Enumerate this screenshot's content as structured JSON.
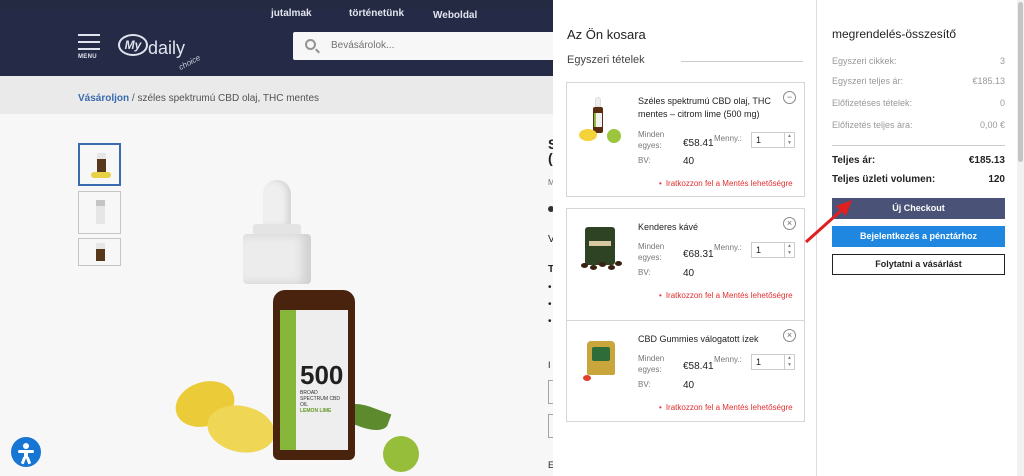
{
  "header": {
    "nav_links": [
      "jutalmak",
      "történetünk",
      "Weboldal"
    ],
    "menu_label": "MENU",
    "logo_my": "My",
    "logo_daily": "daily",
    "logo_choice": "choice",
    "search_placeholder": "Bevásárolok..."
  },
  "breadcrumb": {
    "home": "Vásároljon",
    "rest": " / széles spektrumú CBD olaj, THC mentes"
  },
  "product_label": {
    "number": "500",
    "sub": "BROAD SPECTRUM CBD OIL",
    "flavor": "LEMON LIME"
  },
  "product_fragments": [
    "S",
    "(",
    "M",
    "V",
    "T",
    "•",
    "•",
    "•",
    "I",
    "E"
  ],
  "cart": {
    "title": "Az Ön kosara",
    "section_label": "Egyszeri tételek",
    "unit_label": "Minden egyes:",
    "qty_label": "Menny.:",
    "bv_label": "BV:",
    "promo_text": "Iratkozzon fel a Mentés lehetőségre",
    "items": [
      {
        "name": "Széles spektrumú CBD olaj, THC mentes – citrom lime (500 mg)",
        "price": "€58.41",
        "qty": "1",
        "bv": "40"
      },
      {
        "name": "Kenderes kávé",
        "price": "€68.31",
        "qty": "1",
        "bv": "40"
      },
      {
        "name": "CBD Gummies válogatott ízek",
        "price": "€58.41",
        "qty": "1",
        "bv": "40"
      }
    ]
  },
  "summary": {
    "title": "megrendelés-összesítő",
    "rows": [
      {
        "label": "Egyszeri cikkek:",
        "value": "3"
      },
      {
        "label": "Egyszeri teljes ár:",
        "value": "€185.13"
      },
      {
        "label": "Előfizetéses tételek:",
        "value": "0"
      },
      {
        "label": "Előfizetés teljes ára:",
        "value": "0,00 €"
      }
    ],
    "total_label": "Teljes ár:",
    "total_value": "€185.13",
    "volume_label": "Teljes üzleti volumen:",
    "volume_value": "120",
    "btn_checkout": "Új Checkout",
    "btn_login": "Bejelentkezés a pénztárhoz",
    "btn_continue": "Folytatni a vásárlást"
  },
  "icons": [
    "search-icon",
    "menu-icon",
    "close-icon",
    "accessibility-icon",
    "arrow-icon"
  ],
  "colors": {
    "header": "#272d4a",
    "checkout": "#4a5278",
    "login": "#1f87e0",
    "promo": "#e03030",
    "arrow": "#e02020"
  }
}
